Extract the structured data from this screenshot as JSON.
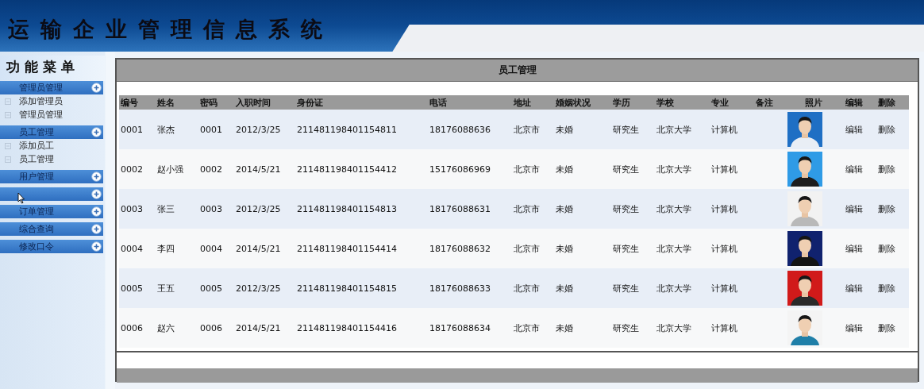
{
  "header": {
    "title": "运输企业管理信息系统"
  },
  "sidebar": {
    "title": "功能菜单",
    "groups": [
      {
        "label": "管理员管理",
        "hovered": false,
        "children": [
          {
            "label": "添加管理员"
          },
          {
            "label": "管理员管理"
          }
        ]
      },
      {
        "label": "员工管理",
        "hovered": false,
        "children": [
          {
            "label": "添加员工"
          },
          {
            "label": "员工管理"
          }
        ]
      },
      {
        "label": "用户管理",
        "hovered": false
      },
      {
        "hovered": true
      },
      {
        "label": "订单管理",
        "hovered": false
      },
      {
        "label": "综合查询",
        "hovered": false
      },
      {
        "label": "修改口令",
        "hovered": false
      }
    ]
  },
  "panel": {
    "title": "员工管理",
    "table": {
      "columns": [
        "编号",
        "姓名",
        "密码",
        "入职时间",
        "身份证",
        "电话",
        "地址",
        "婚姻状况",
        "学历",
        "学校",
        "专业",
        "备注",
        "照片",
        "编辑",
        "删除"
      ],
      "rows": [
        {
          "cells": [
            "0001",
            "张杰",
            "0001",
            "2012/3/25",
            "211481198401154811",
            "18176088636",
            "北京市",
            "未婚",
            "研究生",
            "北京大学",
            "计算机"
          ],
          "edit": "编辑",
          "delete": "删除"
        },
        {
          "cells": [
            "0002",
            "赵小强",
            "0002",
            "2014/5/21",
            "211481198401154412",
            "15176086969",
            "北京市",
            "未婚",
            "研究生",
            "北京大学",
            "计算机"
          ],
          "edit": "编辑",
          "delete": "删除"
        },
        {
          "cells": [
            "0003",
            "张三",
            "0003",
            "2012/3/25",
            "211481198401154813",
            "18176088631",
            "北京市",
            "未婚",
            "研究生",
            "北京大学",
            "计算机"
          ],
          "edit": "编辑",
          "delete": "删除"
        },
        {
          "cells": [
            "0004",
            "李四",
            "0004",
            "2014/5/21",
            "211481198401154414",
            "18176088632",
            "北京市",
            "未婚",
            "研究生",
            "北京大学",
            "计算机"
          ],
          "edit": "编辑",
          "delete": "删除"
        },
        {
          "cells": [
            "0005",
            "王五",
            "0005",
            "2012/3/25",
            "211481198401154815",
            "18176088633",
            "北京市",
            "未婚",
            "研究生",
            "北京大学",
            "计算机"
          ],
          "edit": "编辑",
          "delete": "删除"
        },
        {
          "cells": [
            "0006",
            "赵六",
            "0006",
            "2014/5/21",
            "211481198401154416",
            "18176088634",
            "北京市",
            "未婚",
            "研究生",
            "北京大学",
            "计算机"
          ],
          "edit": "编辑",
          "delete": "删除"
        }
      ]
    }
  }
}
